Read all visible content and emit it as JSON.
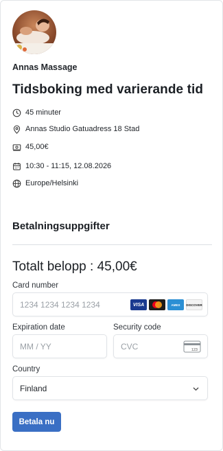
{
  "organizer": {
    "name": "Annas Massage"
  },
  "event": {
    "title": "Tidsboking med varierande tid",
    "duration": "45 minuter",
    "location": "Annas Studio Gatuadress 18 Stad",
    "price": "45,00€",
    "datetime": "10:30 - 11:15, 12.08.2026",
    "timezone": "Europe/Helsinki"
  },
  "payment": {
    "section_title": "Betalningsuppgifter",
    "total_label": "Totalt belopp : 45,00€",
    "card_number": {
      "label": "Card number",
      "placeholder": "1234 1234 1234 1234",
      "value": ""
    },
    "card_brands": [
      "VISA",
      "mastercard",
      "AMEX",
      "DISCOVER"
    ],
    "expiry": {
      "label": "Expiration date",
      "placeholder": "MM / YY",
      "value": ""
    },
    "cvc": {
      "label": "Security code",
      "placeholder": "CVC",
      "value": "",
      "icon_text": "123"
    },
    "country": {
      "label": "Country",
      "value": "Finland"
    },
    "submit_label": "Betala nu"
  },
  "colors": {
    "button": "#3a6fc4",
    "visa": "#1a3a8f",
    "amex": "#2b8fd4"
  },
  "icons": [
    "clock-icon",
    "location-pin-icon",
    "money-icon",
    "calendar-icon",
    "globe-icon",
    "cvc-card-icon",
    "chevron-down-icon"
  ]
}
